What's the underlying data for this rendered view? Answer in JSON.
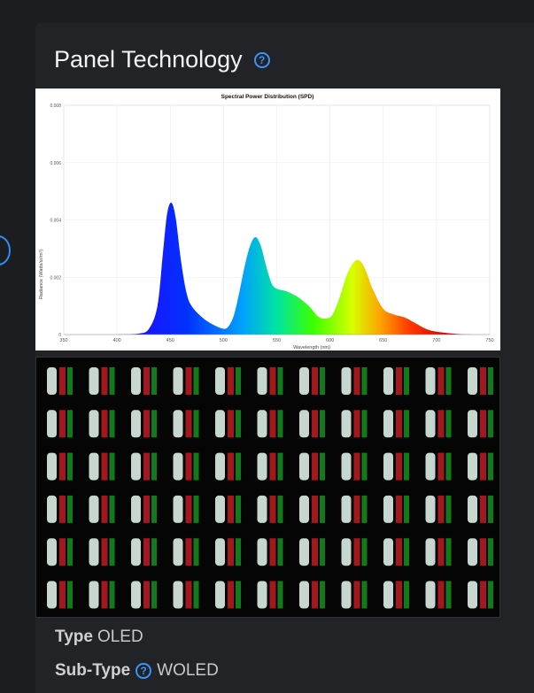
{
  "section": {
    "title": "Panel Technology"
  },
  "chart_data": {
    "type": "area",
    "title": "Spectral Power Distribution (SPD)",
    "xlabel": "Wavelength (nm)",
    "ylabel": "Radiance (Watts/sr/m²)",
    "xlim": [
      350,
      750
    ],
    "ylim": [
      0,
      0.008
    ],
    "x_ticks": [
      "350",
      "400",
      "450",
      "500",
      "550",
      "600",
      "650",
      "700",
      "750"
    ],
    "y_ticks": [
      "0.008",
      "0.006",
      "0.004",
      "0.002",
      "0"
    ],
    "grid": true,
    "x": [
      400,
      420,
      430,
      438,
      443,
      447,
      451,
      455,
      460,
      465,
      470,
      480,
      490,
      500,
      505,
      510,
      515,
      520,
      525,
      530,
      535,
      540,
      545,
      550,
      560,
      570,
      580,
      590,
      600,
      605,
      610,
      615,
      620,
      625,
      630,
      635,
      640,
      650,
      660,
      670,
      680,
      690,
      700,
      720,
      735
    ],
    "values": [
      0,
      3e-05,
      0.0002,
      0.001,
      0.0028,
      0.0042,
      0.0046,
      0.0041,
      0.0026,
      0.0015,
      0.001,
      0.0006,
      0.00035,
      0.0002,
      0.0003,
      0.0007,
      0.0015,
      0.0024,
      0.0031,
      0.0034,
      0.0031,
      0.0024,
      0.0018,
      0.0016,
      0.0015,
      0.0013,
      0.001,
      0.0006,
      0.0006,
      0.0009,
      0.0014,
      0.002,
      0.0024,
      0.0026,
      0.0025,
      0.0021,
      0.0016,
      0.0009,
      0.0007,
      0.0006,
      0.0004,
      0.0002,
      0.0001,
      2e-05,
      0
    ]
  },
  "subpixel": {
    "rows": 6,
    "cols": 11,
    "colors": {
      "white": "#c7d6cf",
      "red": "#a3171e",
      "green": "#137a1c"
    }
  },
  "specs": {
    "type_label": "Type",
    "type_value": "OLED",
    "subtype_label": "Sub-Type",
    "subtype_value": "WOLED"
  },
  "colors": {
    "accent": "#3a93ff",
    "background": "#1c1d20"
  }
}
